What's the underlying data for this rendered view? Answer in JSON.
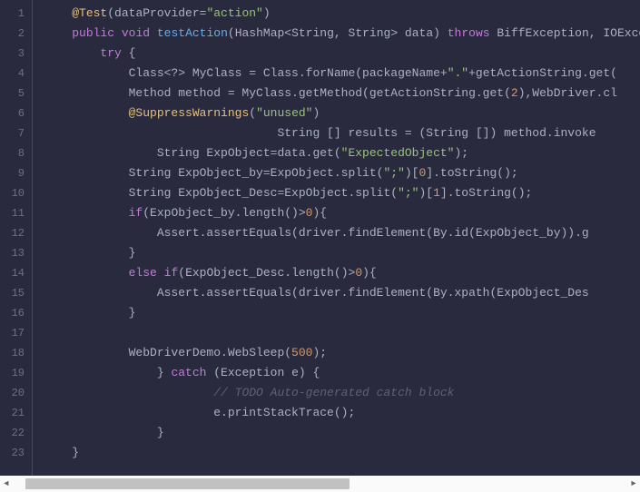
{
  "code": {
    "lines": [
      {
        "n": 1,
        "segments": [
          {
            "t": "    ",
            "c": "txt"
          },
          {
            "t": "@Test",
            "c": "ann"
          },
          {
            "t": "(dataProvider=",
            "c": "txt"
          },
          {
            "t": "\"action\"",
            "c": "str"
          },
          {
            "t": ")",
            "c": "txt"
          }
        ]
      },
      {
        "n": 2,
        "segments": [
          {
            "t": "    ",
            "c": "txt"
          },
          {
            "t": "public",
            "c": "kw"
          },
          {
            "t": " ",
            "c": "txt"
          },
          {
            "t": "void",
            "c": "kw"
          },
          {
            "t": " ",
            "c": "txt"
          },
          {
            "t": "testAction",
            "c": "fn"
          },
          {
            "t": "(HashMap<String, String> data) ",
            "c": "txt"
          },
          {
            "t": "throws",
            "c": "kw"
          },
          {
            "t": " BiffException, IOExce",
            "c": "txt"
          }
        ]
      },
      {
        "n": 3,
        "segments": [
          {
            "t": "        ",
            "c": "txt"
          },
          {
            "t": "try",
            "c": "kw"
          },
          {
            "t": " {",
            "c": "txt"
          }
        ]
      },
      {
        "n": 4,
        "segments": [
          {
            "t": "            Class<?> MyClass = Class.forName(packageName+",
            "c": "txt"
          },
          {
            "t": "\".\"",
            "c": "str"
          },
          {
            "t": "+getActionString.get(",
            "c": "txt"
          }
        ]
      },
      {
        "n": 5,
        "segments": [
          {
            "t": "            Method method = MyClass.getMethod(getActionString.get(",
            "c": "txt"
          },
          {
            "t": "2",
            "c": "num"
          },
          {
            "t": "),WebDriver.cl",
            "c": "txt"
          }
        ]
      },
      {
        "n": 6,
        "segments": [
          {
            "t": "            ",
            "c": "txt"
          },
          {
            "t": "@SuppressWarnings",
            "c": "ann"
          },
          {
            "t": "(",
            "c": "txt"
          },
          {
            "t": "\"unused\"",
            "c": "str"
          },
          {
            "t": ")",
            "c": "txt"
          }
        ]
      },
      {
        "n": 7,
        "segments": [
          {
            "t": "                                 String [] results = (String []) method.invoke",
            "c": "txt"
          }
        ]
      },
      {
        "n": 8,
        "segments": [
          {
            "t": "                String ExpObject=data.get(",
            "c": "txt"
          },
          {
            "t": "\"ExpectedObject\"",
            "c": "str"
          },
          {
            "t": ");",
            "c": "txt"
          }
        ]
      },
      {
        "n": 9,
        "segments": [
          {
            "t": "            String ExpObject_by=ExpObject.split(",
            "c": "txt"
          },
          {
            "t": "\";\"",
            "c": "str"
          },
          {
            "t": ")[",
            "c": "txt"
          },
          {
            "t": "0",
            "c": "num"
          },
          {
            "t": "].toString();",
            "c": "txt"
          }
        ]
      },
      {
        "n": 10,
        "segments": [
          {
            "t": "            String ExpObject_Desc=ExpObject.split(",
            "c": "txt"
          },
          {
            "t": "\";\"",
            "c": "str"
          },
          {
            "t": ")[",
            "c": "txt"
          },
          {
            "t": "1",
            "c": "num"
          },
          {
            "t": "].toString();",
            "c": "txt"
          }
        ]
      },
      {
        "n": 11,
        "segments": [
          {
            "t": "            ",
            "c": "txt"
          },
          {
            "t": "if",
            "c": "kw"
          },
          {
            "t": "(ExpObject_by.length()>",
            "c": "txt"
          },
          {
            "t": "0",
            "c": "num"
          },
          {
            "t": "){",
            "c": "txt"
          }
        ]
      },
      {
        "n": 12,
        "segments": [
          {
            "t": "                Assert.assertEquals(driver.findElement(By.id(ExpObject_by)).g",
            "c": "txt"
          }
        ]
      },
      {
        "n": 13,
        "segments": [
          {
            "t": "            }",
            "c": "txt"
          }
        ]
      },
      {
        "n": 14,
        "segments": [
          {
            "t": "            ",
            "c": "txt"
          },
          {
            "t": "else",
            "c": "kw"
          },
          {
            "t": " ",
            "c": "txt"
          },
          {
            "t": "if",
            "c": "kw"
          },
          {
            "t": "(ExpObject_Desc.length()>",
            "c": "txt"
          },
          {
            "t": "0",
            "c": "num"
          },
          {
            "t": "){",
            "c": "txt"
          }
        ]
      },
      {
        "n": 15,
        "segments": [
          {
            "t": "                Assert.assertEquals(driver.findElement(By.xpath(ExpObject_Des",
            "c": "txt"
          }
        ]
      },
      {
        "n": 16,
        "segments": [
          {
            "t": "            }",
            "c": "txt"
          }
        ]
      },
      {
        "n": 17,
        "segments": [
          {
            "t": "",
            "c": "txt"
          }
        ]
      },
      {
        "n": 18,
        "segments": [
          {
            "t": "            WebDriverDemo.WebSleep(",
            "c": "txt"
          },
          {
            "t": "500",
            "c": "num"
          },
          {
            "t": ");",
            "c": "txt"
          }
        ]
      },
      {
        "n": 19,
        "segments": [
          {
            "t": "                } ",
            "c": "txt"
          },
          {
            "t": "catch",
            "c": "kw"
          },
          {
            "t": " (Exception e) {",
            "c": "txt"
          }
        ]
      },
      {
        "n": 20,
        "segments": [
          {
            "t": "                        ",
            "c": "txt"
          },
          {
            "t": "// TODO Auto-generated catch block",
            "c": "cmt"
          }
        ]
      },
      {
        "n": 21,
        "segments": [
          {
            "t": "                        e.printStackTrace();",
            "c": "txt"
          }
        ]
      },
      {
        "n": 22,
        "segments": [
          {
            "t": "                }",
            "c": "txt"
          }
        ]
      },
      {
        "n": 23,
        "segments": [
          {
            "t": "    }",
            "c": "txt"
          }
        ]
      }
    ]
  },
  "scroll": {
    "left_arrow": "◄",
    "right_arrow": "►"
  }
}
